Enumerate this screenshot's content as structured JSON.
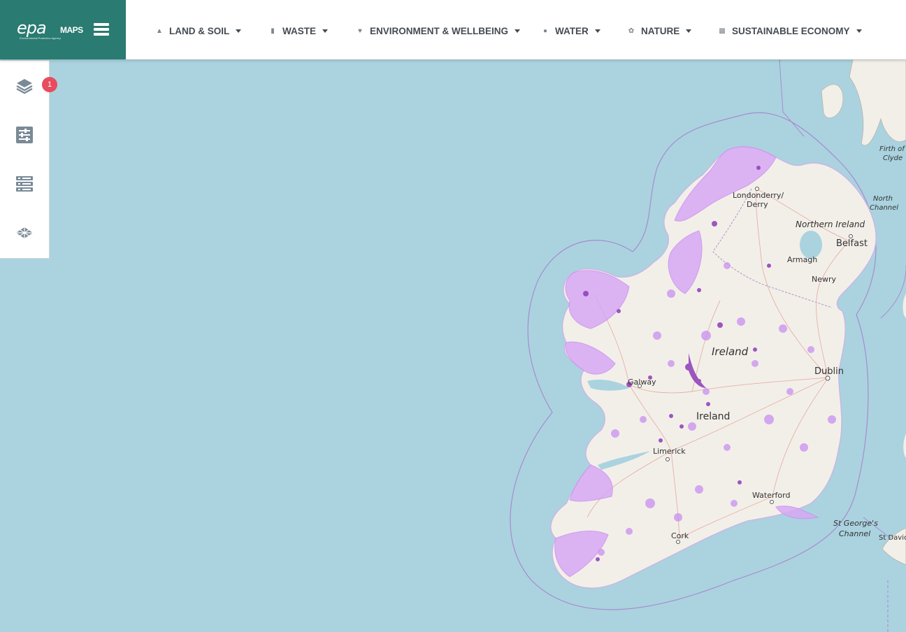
{
  "header": {
    "logo_text": "epa",
    "logo_maps": "MAPS",
    "logo_sub": "Environmental Protection Agency",
    "menu_icon": "hamburger-icon",
    "nav": [
      {
        "label": "LAND & SOIL",
        "icon": "land-icon"
      },
      {
        "label": "WASTE",
        "icon": "bin-icon"
      },
      {
        "label": "ENVIRONMENT & WELLBEING",
        "icon": "heart-icon"
      },
      {
        "label": "WATER",
        "icon": "water-drop-icon"
      },
      {
        "label": "NATURE",
        "icon": "leaf-icon"
      },
      {
        "label": "SUSTAINABLE ECONOMY",
        "icon": "factory-icon"
      }
    ]
  },
  "toolbar": {
    "layers_badge": "1",
    "tools": [
      {
        "name": "layers",
        "icon": "layers-icon"
      },
      {
        "name": "filters",
        "icon": "sliders-icon"
      },
      {
        "name": "data",
        "icon": "database-list-icon"
      },
      {
        "name": "basemap",
        "icon": "basemap-icon"
      }
    ]
  },
  "map": {
    "labels": {
      "londonderry": "Londonderry/",
      "derry": "Derry",
      "northern_ireland": "Northern Ireland",
      "belfast": "Belfast",
      "armagh": "Armagh",
      "newry": "Newry",
      "ireland_italic": "Ireland",
      "ireland": "Ireland",
      "dublin": "Dublin",
      "galway": "Galway",
      "limerick": "Limerick",
      "waterford": "Waterford",
      "cork": "Cork",
      "st_georges": "St George's",
      "channel": "Channel",
      "st_davids": "St Davic",
      "north": "North",
      "north_channel": "Channel",
      "firth_of": "Firth of",
      "clyde": "Clyde"
    },
    "colors": {
      "sea": "#aad3df",
      "land": "#f2efe9",
      "overlay": "#c98ff0",
      "overlay_dark": "#8e3cb8",
      "roads": "#e8a8a0"
    }
  }
}
